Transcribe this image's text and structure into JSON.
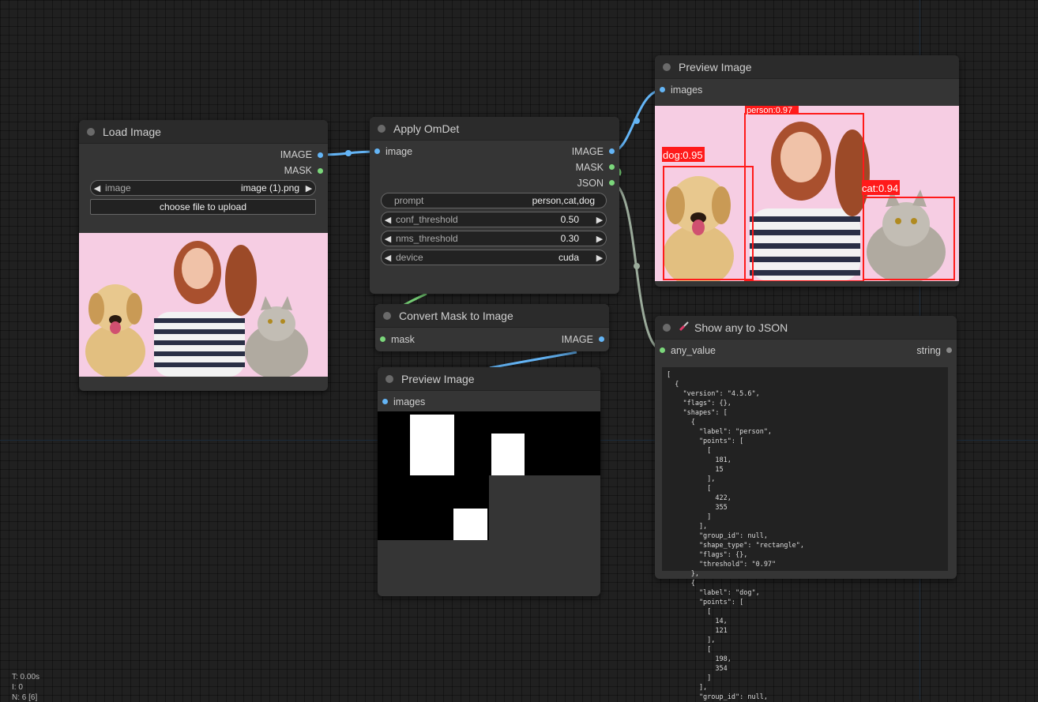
{
  "nodes": {
    "load_image": {
      "title": "Load Image",
      "outputs": [
        "IMAGE",
        "MASK"
      ],
      "image_widget": {
        "label": "image",
        "value": "image (1).png"
      },
      "upload_label": "choose file to upload"
    },
    "apply_omdet": {
      "title": "Apply OmDet",
      "input": "image",
      "outputs": [
        "IMAGE",
        "MASK",
        "JSON"
      ],
      "prompt": {
        "label": "prompt",
        "value": "person,cat,dog"
      },
      "conf_threshold": {
        "label": "conf_threshold",
        "value": "0.50"
      },
      "nms_threshold": {
        "label": "nms_threshold",
        "value": "0.30"
      },
      "device": {
        "label": "device",
        "value": "cuda"
      }
    },
    "convert_mask": {
      "title": "Convert Mask to Image",
      "input": "mask",
      "output": "IMAGE"
    },
    "preview_top": {
      "title": "Preview Image",
      "input": "images",
      "detections": [
        {
          "label": "person:0.97"
        },
        {
          "label": "dog:0.95"
        },
        {
          "label": "cat:0.94"
        }
      ]
    },
    "preview_mask": {
      "title": "Preview Image",
      "input": "images"
    },
    "show_json": {
      "title": "Show any to JSON",
      "input": "any_value",
      "output": "string",
      "json_text": "[\n  {\n    \"version\": \"4.5.6\",\n    \"flags\": {},\n    \"shapes\": [\n      {\n        \"label\": \"person\",\n        \"points\": [\n          [\n            181,\n            15\n          ],\n          [\n            422,\n            355\n          ]\n        ],\n        \"group_id\": null,\n        \"shape_type\": \"rectangle\",\n        \"flags\": {},\n        \"threshold\": \"0.97\"\n      },\n      {\n        \"label\": \"dog\",\n        \"points\": [\n          [\n            14,\n            121\n          ],\n          [\n            198,\n            354\n          ]\n        ],\n        \"group_id\": null,"
    }
  },
  "status": {
    "time": "T: 0.00s",
    "i": "I: 0",
    "n": "N: 6 [6]"
  },
  "colors": {
    "image_wire": "#64b5f6",
    "mask_wire": "#7bd77b",
    "json_wire": "#9aaa9a",
    "detection_box": "#ff1a1a",
    "canvas_bg": "#202020"
  }
}
